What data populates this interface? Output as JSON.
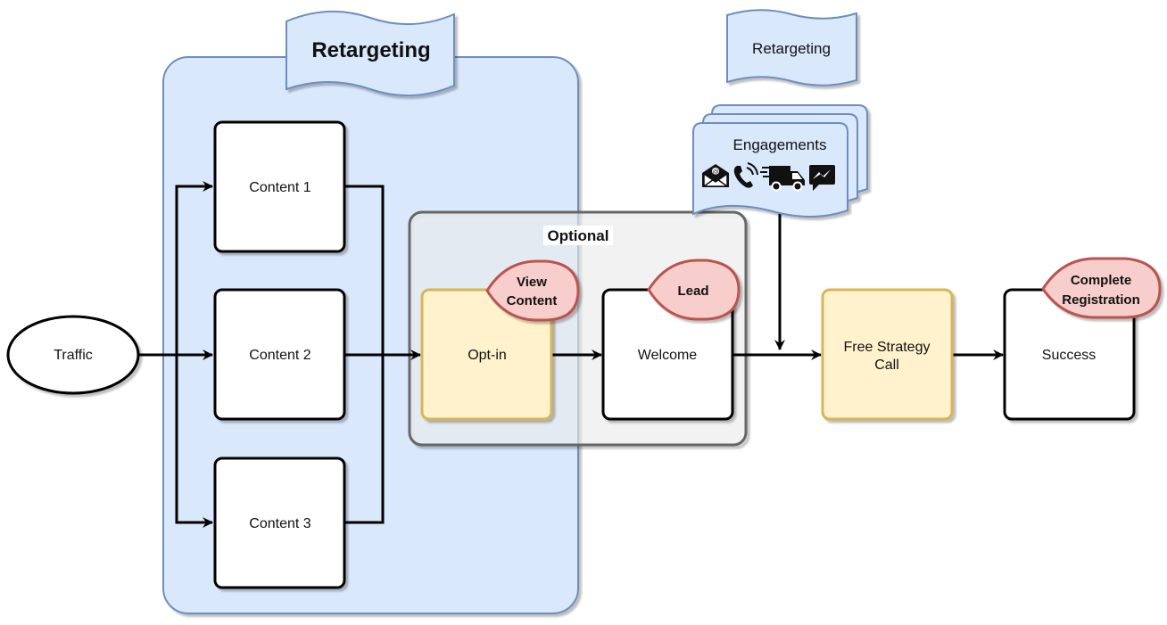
{
  "diagram": {
    "colors": {
      "retargeting_fill": "#dae8fc",
      "retargeting_stroke": "#6c8ebf",
      "optional_fill": "#f5f5f5",
      "optional_stroke": "#666666",
      "highlight_fill": "#fff2cc",
      "highlight_stroke": "#d6b656",
      "event_fill": "#f8cecc",
      "event_stroke": "#b85450",
      "line": "#000000"
    },
    "groups": {
      "retargeting_main": {
        "label": "Retargeting"
      },
      "optional": {
        "label": "Optional"
      }
    },
    "nodes": {
      "traffic": {
        "label": "Traffic"
      },
      "content1": {
        "label": "Content 1"
      },
      "content2": {
        "label": "Content 2"
      },
      "content3": {
        "label": "Content 3"
      },
      "optin": {
        "label": "Opt-in"
      },
      "welcome": {
        "label": "Welcome"
      },
      "strategy_call": {
        "line1": "Free Strategy",
        "line2": "Call"
      },
      "success": {
        "label": "Success"
      }
    },
    "events": {
      "view_content": {
        "line1": "View",
        "line2": "Content"
      },
      "lead": {
        "label": "Lead"
      },
      "complete_registration": {
        "line1": "Complete",
        "line2": "Registration"
      }
    },
    "engagements": {
      "retargeting_label": "Retargeting",
      "title": "Engagements",
      "icons": [
        "email-icon",
        "phone-call-icon",
        "delivery-truck-icon",
        "messenger-icon"
      ]
    },
    "edges": [
      {
        "from": "Traffic",
        "to": "Content 1"
      },
      {
        "from": "Traffic",
        "to": "Content 2"
      },
      {
        "from": "Traffic",
        "to": "Content 3"
      },
      {
        "from": "Content 1",
        "to": "Opt-in"
      },
      {
        "from": "Content 2",
        "to": "Opt-in"
      },
      {
        "from": "Content 3",
        "to": "Opt-in"
      },
      {
        "from": "Opt-in",
        "to": "Welcome"
      },
      {
        "from": "Welcome",
        "to": "Free Strategy Call"
      },
      {
        "from": "Engagements",
        "to": "Free Strategy Call"
      },
      {
        "from": "Free Strategy Call",
        "to": "Success"
      }
    ]
  }
}
